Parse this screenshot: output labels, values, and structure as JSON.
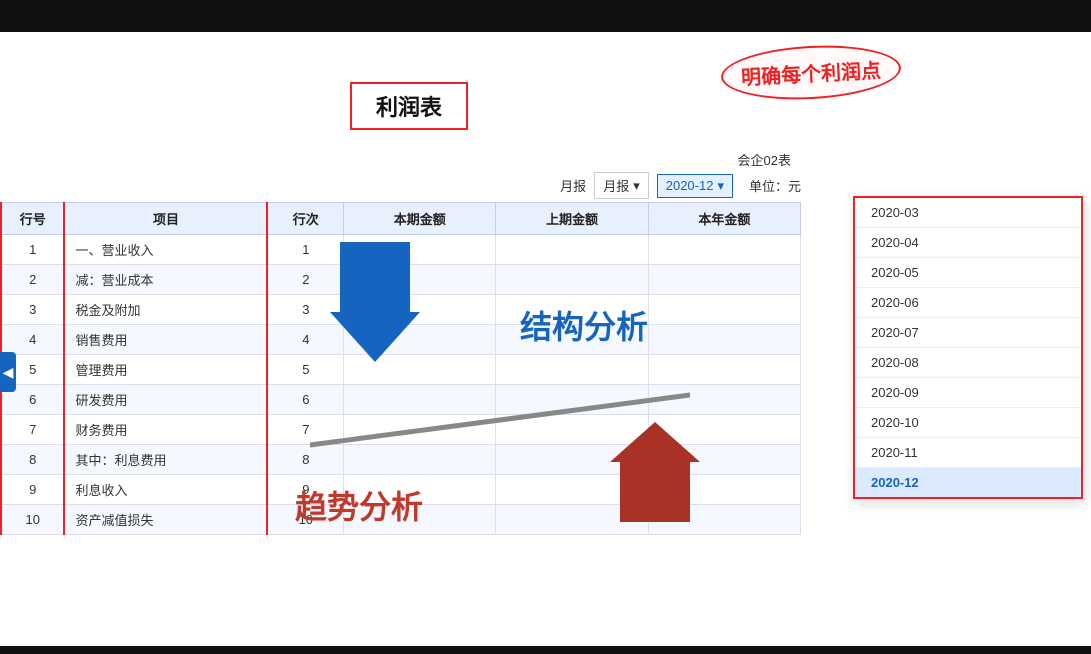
{
  "topBar": {
    "visible": true
  },
  "speechBubble": {
    "text": "明确每个利润点"
  },
  "title": {
    "text": "利润表"
  },
  "company": {
    "text": "会企02表"
  },
  "controls": {
    "periodLabel": "月报",
    "selectedPeriod": "2020-12",
    "unit": "单位：元"
  },
  "table": {
    "headers": [
      "行号",
      "项目",
      "行次",
      "本期金额",
      "上期金额",
      "本年金额"
    ],
    "rows": [
      {
        "num": "1",
        "item": "一、营业收入",
        "order": "1",
        "current": "",
        "prev": "",
        "annual": ""
      },
      {
        "num": "2",
        "item": "减：营业成本",
        "order": "2",
        "current": "",
        "prev": "",
        "annual": ""
      },
      {
        "num": "3",
        "item": "税金及附加",
        "order": "3",
        "current": "",
        "prev": "",
        "annual": ""
      },
      {
        "num": "4",
        "item": "销售费用",
        "order": "4",
        "current": "",
        "prev": "",
        "annual": ""
      },
      {
        "num": "5",
        "item": "管理费用",
        "order": "5",
        "current": "",
        "prev": "",
        "annual": ""
      },
      {
        "num": "6",
        "item": "研发费用",
        "order": "6",
        "current": "",
        "prev": "",
        "annual": ""
      },
      {
        "num": "7",
        "item": "财务费用",
        "order": "7",
        "current": "",
        "prev": "",
        "annual": ""
      },
      {
        "num": "8",
        "item": "其中：利息费用",
        "order": "8",
        "current": "",
        "prev": "",
        "annual": ""
      },
      {
        "num": "9",
        "item": "利息收入",
        "order": "9",
        "current": "",
        "prev": "",
        "annual": ""
      },
      {
        "num": "10",
        "item": "资产减值损失",
        "order": "10",
        "current": "",
        "prev": "",
        "annual": ""
      }
    ]
  },
  "annotations": {
    "structureLabel": "结构分析",
    "trendLabel": "趋势分析"
  },
  "dropdown": {
    "items": [
      {
        "value": "2020-03",
        "label": "2020-03"
      },
      {
        "value": "2020-04",
        "label": "2020-04"
      },
      {
        "value": "2020-05",
        "label": "2020-05"
      },
      {
        "value": "2020-06",
        "label": "2020-06"
      },
      {
        "value": "2020-07",
        "label": "2020-07"
      },
      {
        "value": "2020-08",
        "label": "2020-08"
      },
      {
        "value": "2020-09",
        "label": "2020-09"
      },
      {
        "value": "2020-10",
        "label": "2020-10"
      },
      {
        "value": "2020-11",
        "label": "2020-11"
      },
      {
        "value": "2020-12",
        "label": "2020-12",
        "selected": true
      }
    ]
  },
  "leftToggle": {
    "icon": "◀"
  }
}
